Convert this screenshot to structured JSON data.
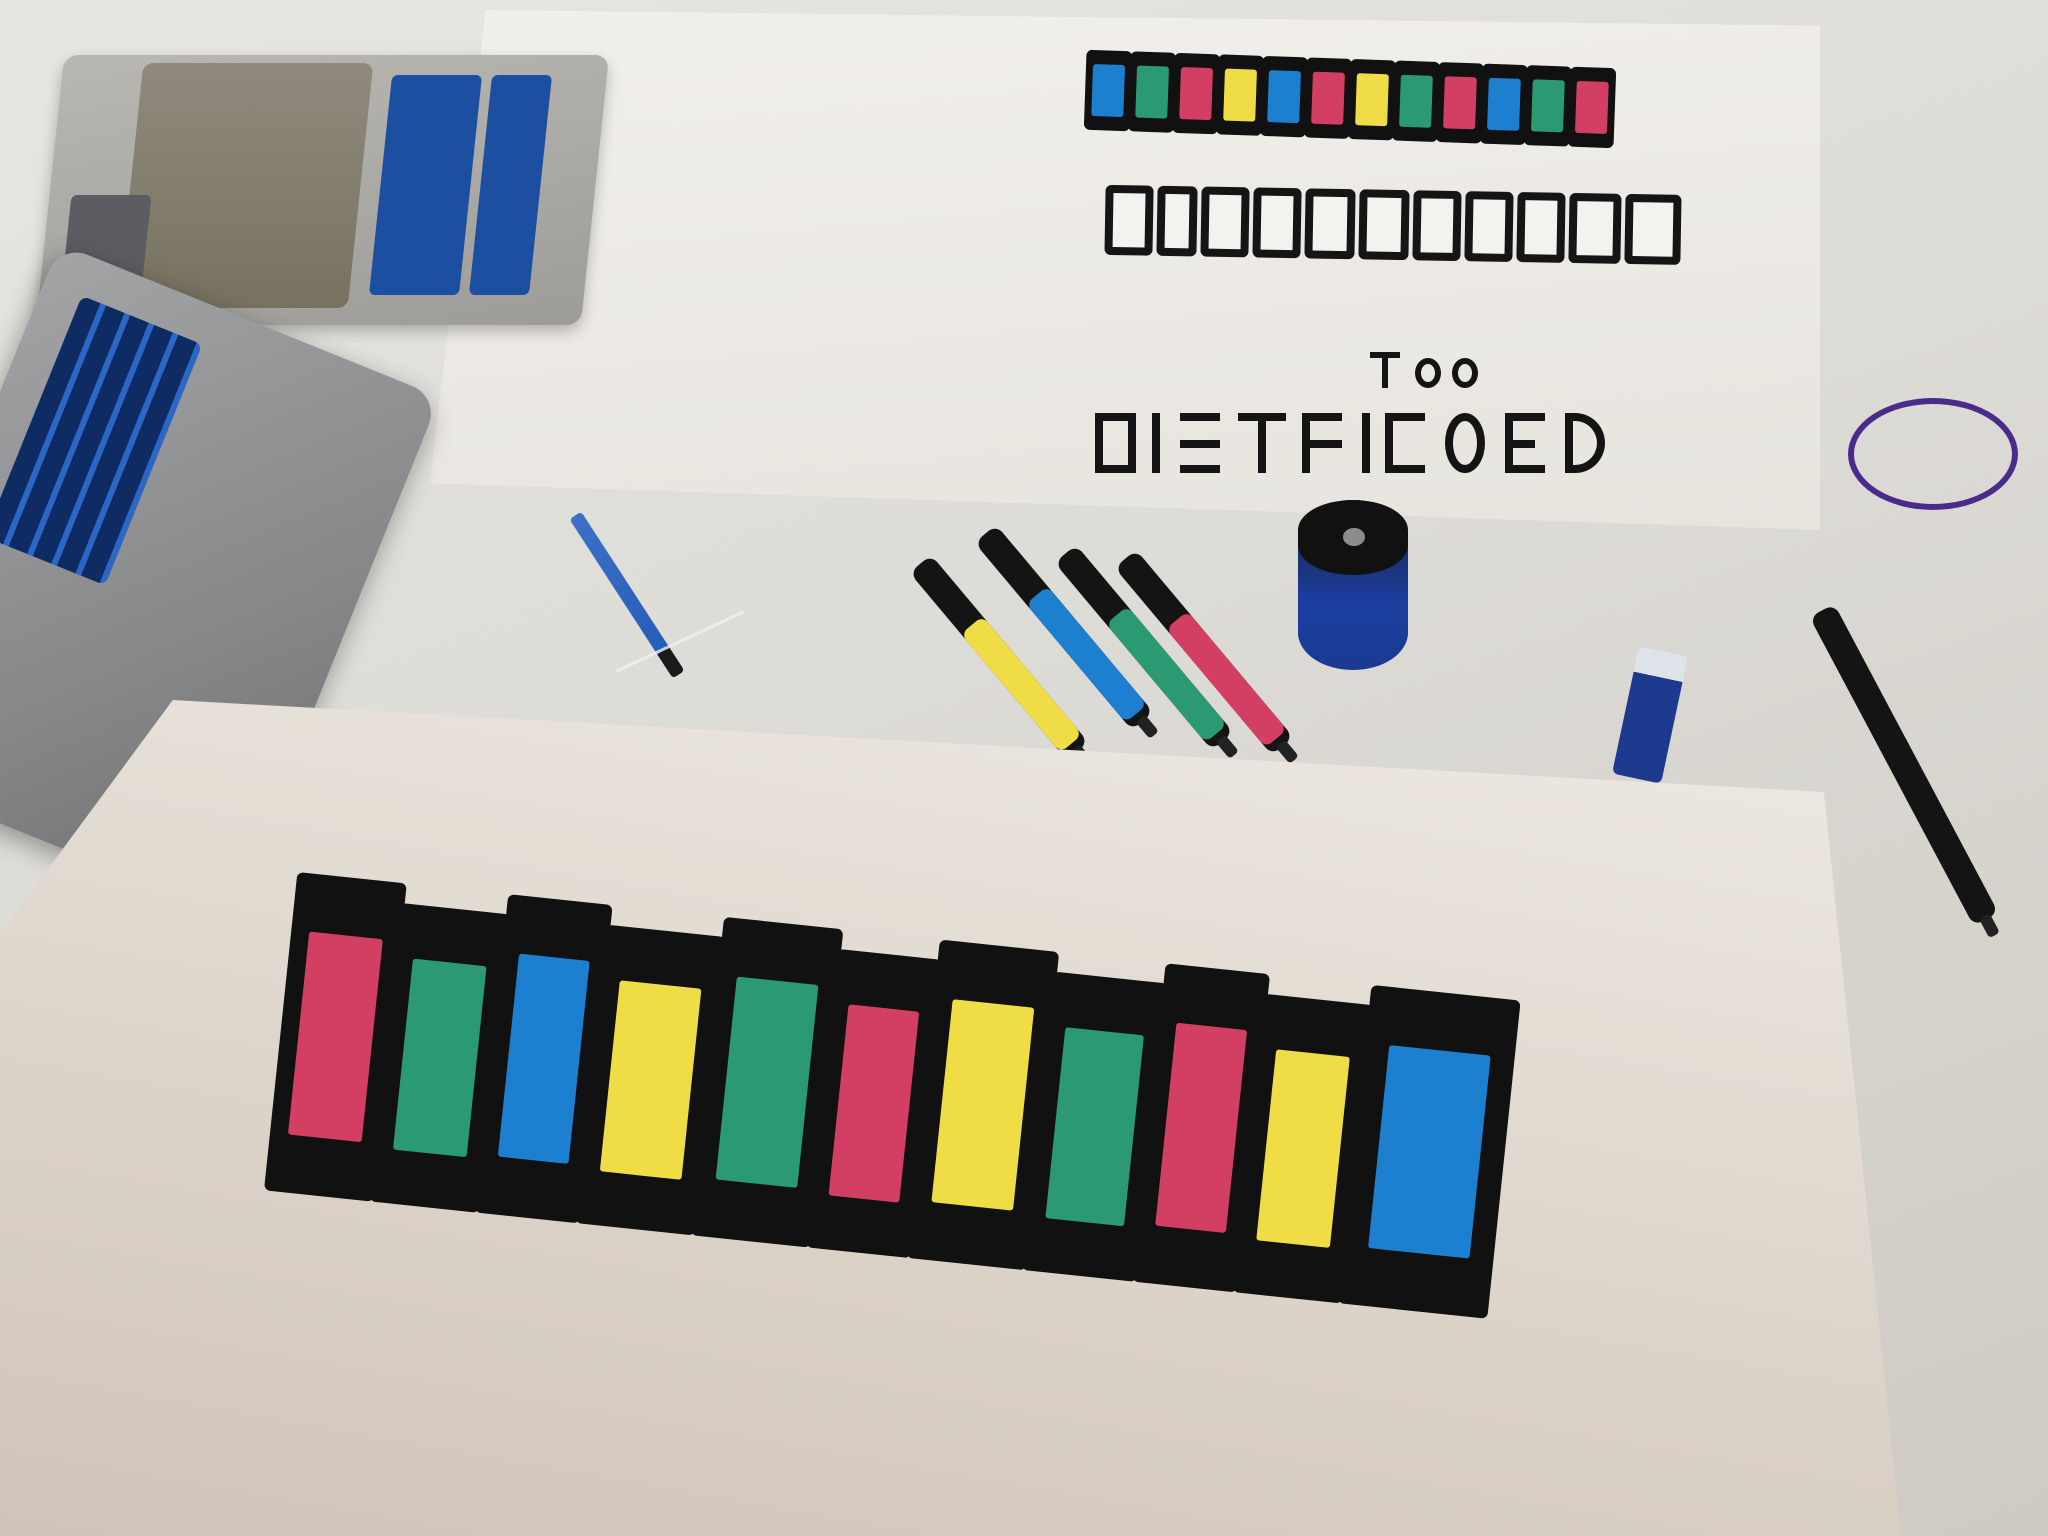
{
  "scene": {
    "description_colors": {
      "red": "#d33f63",
      "blue": "#1d7fd0",
      "yellow": "#f0dd45",
      "green": "#2b9a73",
      "outline": "#111111"
    },
    "markers": [
      {
        "color": "#f0dd45"
      },
      {
        "color": "#1d7fd0"
      },
      {
        "color": "#2b9a73"
      },
      {
        "color": "#d33f63"
      }
    ],
    "big_artwork_letter_colors": [
      "#d33f63",
      "#2b9a73",
      "#1d7fd0",
      "#f0dd45",
      "#2b9a73",
      "#d33f63",
      "#f0dd45",
      "#2b9a73",
      "#d33f63",
      "#f0dd45",
      "#1d7fd0"
    ],
    "small_artwork_letter_colors": [
      "#1d7fd0",
      "#2b9a73",
      "#d33f63",
      "#f0dd45",
      "#1d7fd0",
      "#d33f63",
      "#f0dd45",
      "#2b9a73",
      "#d33f63",
      "#1d7fd0",
      "#2b9a73",
      "#d33f63"
    ]
  }
}
